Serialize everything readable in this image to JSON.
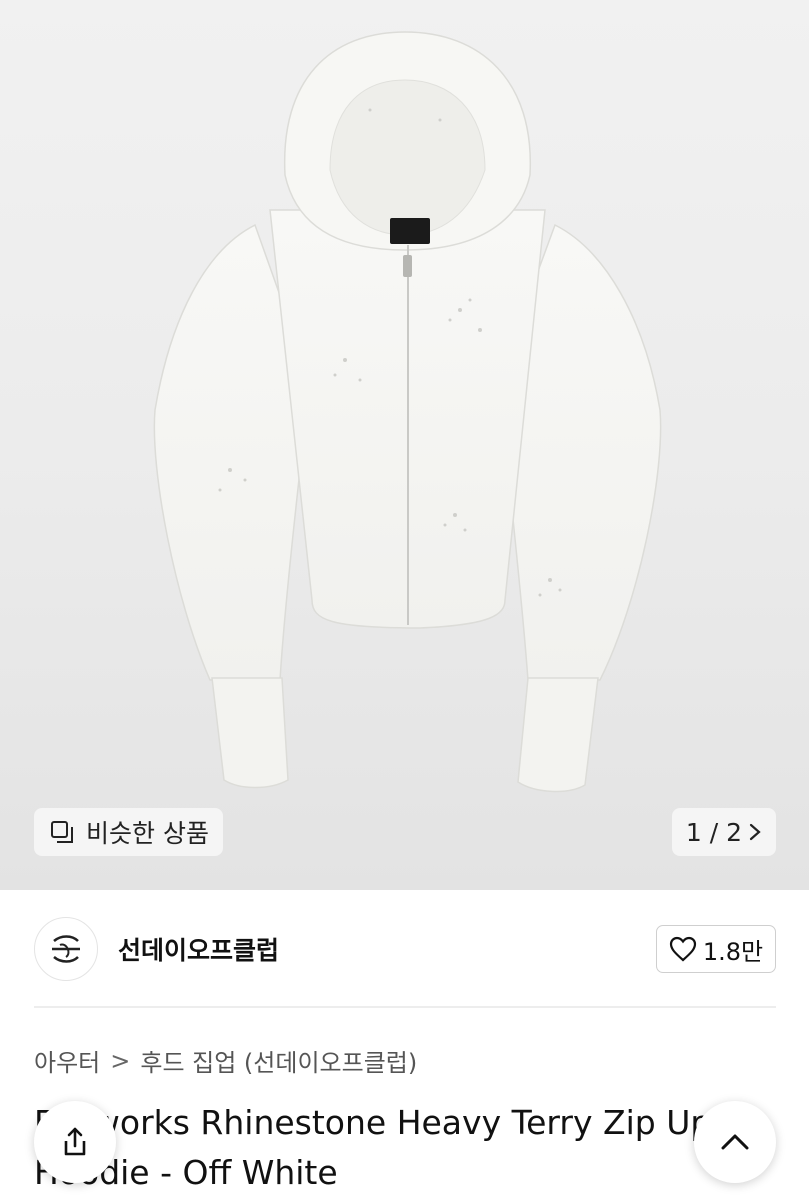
{
  "gallery": {
    "similar_label": "비슷한 상품",
    "counter": "1 / 2"
  },
  "seller": {
    "name": "선데이오프클럽",
    "likes": "1.8만"
  },
  "breadcrumb": [
    "아우터",
    "후드 집업 (선데이오프클럽)"
  ],
  "product": {
    "title": "Fireworks Rhinestone Heavy Terry Zip Up Hoodie - Off White"
  },
  "colors": {
    "hoodie": "#f6f6f3",
    "background": "#ececec"
  }
}
